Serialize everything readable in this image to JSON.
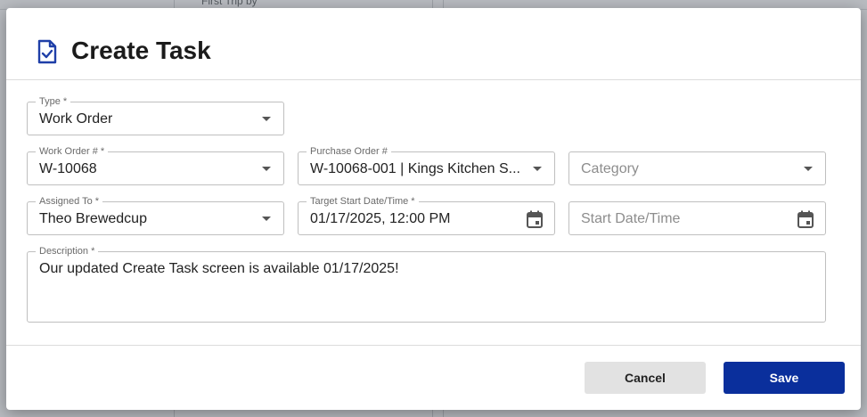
{
  "dialog": {
    "title": "Create Task"
  },
  "fields": {
    "type": {
      "label": "Type *",
      "value": "Work Order"
    },
    "work_order": {
      "label": "Work Order # *",
      "value": "W-10068"
    },
    "purchase_order": {
      "label": "Purchase Order #",
      "value": "W-10068-001 | Kings Kitchen S..."
    },
    "category": {
      "placeholder": "Category"
    },
    "assigned_to": {
      "label": "Assigned To *",
      "value": "Theo Brewedcup"
    },
    "target_start": {
      "label": "Target Start Date/Time *",
      "value": "01/17/2025, 12:00 PM"
    },
    "start_date": {
      "placeholder": "Start Date/Time"
    },
    "description": {
      "label": "Description *",
      "value": "Our updated Create Task screen is available 01/17/2025!"
    }
  },
  "buttons": {
    "cancel": "Cancel",
    "save": "Save"
  },
  "background": {
    "fragment_1": "First Trip by"
  },
  "colors": {
    "primary": "#0a2f9c",
    "title_icon": "#1f3fa8"
  }
}
